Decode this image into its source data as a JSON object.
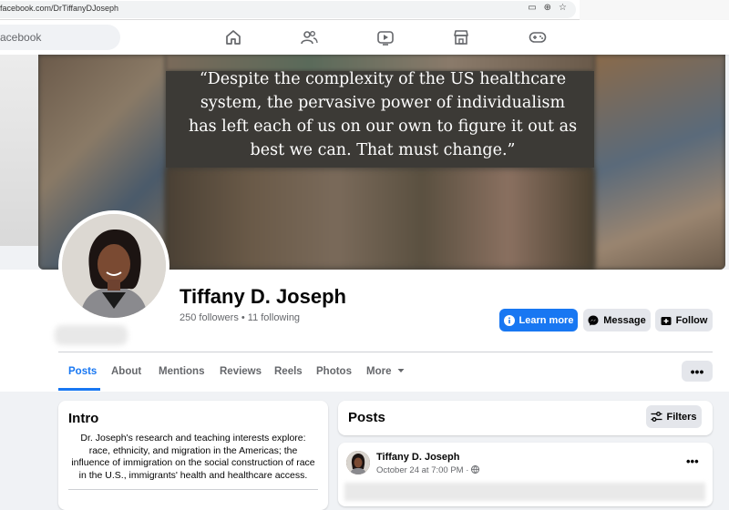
{
  "browser": {
    "url": "facebook.com/DrTiffanyDJoseph"
  },
  "nav": {
    "search_placeholder": "acebook",
    "icons": [
      "home-icon",
      "friends-icon",
      "watch-icon",
      "marketplace-icon",
      "gaming-icon"
    ]
  },
  "cover": {
    "quote_lines": [
      "“Despite the complexity of the US healthcare",
      "system, the pervasive power of individualism",
      "has left each of us on our own to figure it out as",
      "best we can. That must change.”"
    ]
  },
  "profile": {
    "name": "Tiffany D. Joseph",
    "stats": "250 followers • 11 following",
    "buttons": {
      "learn_more": "Learn more",
      "message": "Message",
      "follow": "Follow"
    }
  },
  "tabs": {
    "items": [
      "Posts",
      "About",
      "Mentions",
      "Reviews",
      "Reels",
      "Photos",
      "More"
    ],
    "active": "Posts",
    "more_dots": "•••"
  },
  "intro": {
    "title": "Intro",
    "bio": "Dr. Joseph's research and teaching interests explore: race, ethnicity, and migration in the Americas; the influence of immigration on the social construction of race in the U.S., immigrants' health and healthcare access."
  },
  "posts": {
    "title": "Posts",
    "filters_label": "Filters",
    "first_post": {
      "author": "Tiffany D. Joseph",
      "date": "October 24 at 7:00 PM · ",
      "menu": "•••"
    }
  },
  "colors": {
    "brand_blue": "#1877f2",
    "button_gray": "#e4e6eb",
    "page_bg": "#f0f2f5"
  }
}
